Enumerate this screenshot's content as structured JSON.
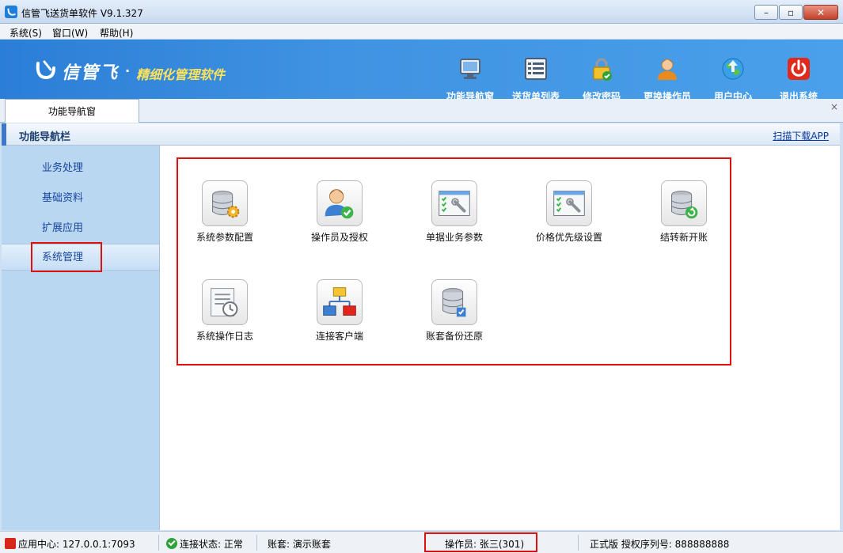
{
  "window": {
    "title": "信管飞送货单软件 V9.1.327"
  },
  "menu": [
    {
      "label": "系统(S)"
    },
    {
      "label": "窗口(W)"
    },
    {
      "label": "帮助(H)"
    }
  ],
  "banner": {
    "logo_text": "信管飞",
    "logo_dot": "·",
    "slogan": "精细化管理软件"
  },
  "toolbar": [
    {
      "label": "功能导航窗",
      "icon": "monitor-icon"
    },
    {
      "label": "送货单列表",
      "icon": "list-icon"
    },
    {
      "label": "修改密码",
      "icon": "lock-icon"
    },
    {
      "label": "更换操作员",
      "icon": "user-icon"
    },
    {
      "label": "用户中心",
      "icon": "globe-icon"
    },
    {
      "label": "退出系统",
      "icon": "power-icon"
    }
  ],
  "tabs": [
    {
      "label": "功能导航窗"
    }
  ],
  "tab_close": "×",
  "nav": {
    "title": "功能导航栏",
    "app_link": "扫描下载APP"
  },
  "sidebar": [
    {
      "label": "业务处理"
    },
    {
      "label": "基础资料"
    },
    {
      "label": "扩展应用"
    },
    {
      "label": "系统管理",
      "active": true
    }
  ],
  "functions": [
    {
      "label": "系统参数配置",
      "icon": "database-gear-icon"
    },
    {
      "label": "操作员及授权",
      "icon": "user-check-icon"
    },
    {
      "label": "单据业务参数",
      "icon": "settings-window-icon"
    },
    {
      "label": "价格优先级设置",
      "icon": "settings-window-icon"
    },
    {
      "label": "结转新开账",
      "icon": "database-refresh-icon"
    },
    {
      "label": "系统操作日志",
      "icon": "log-clock-icon"
    },
    {
      "label": "连接客户端",
      "icon": "network-icon"
    },
    {
      "label": "账套备份还原",
      "icon": "database-check-icon"
    }
  ],
  "status": {
    "app_center": "应用中心: 127.0.0.1:7093",
    "connection": "连接状态: 正常",
    "account": "账套: 演示账套",
    "operator": "操作员: 张三(301)",
    "license": "正式版 授权序列号: 888888888"
  },
  "colors": {
    "highlight": "#e01010",
    "banner": "#3f93e2",
    "sidebar": "#b9d7f1"
  }
}
